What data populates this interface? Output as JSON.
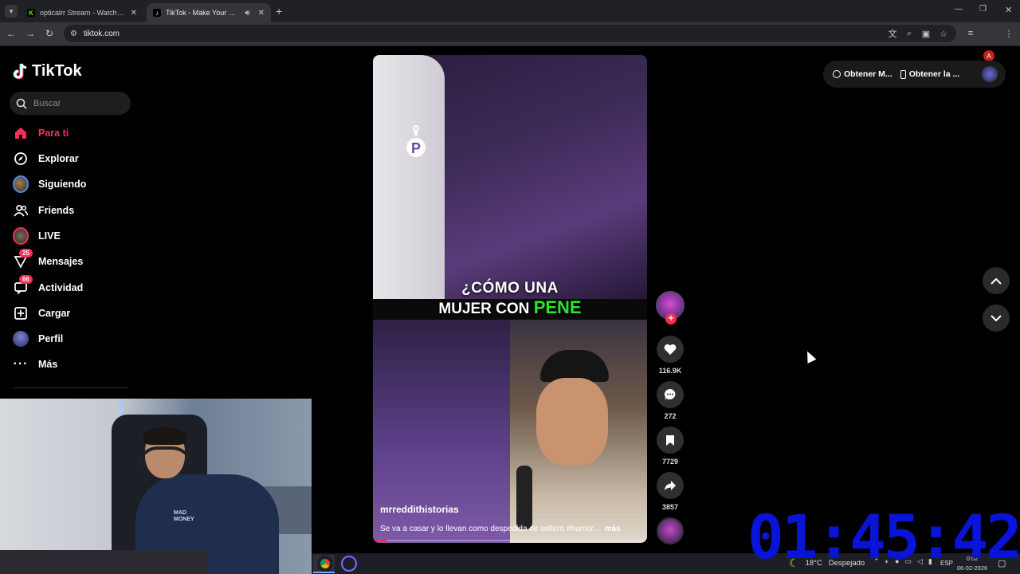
{
  "browser": {
    "tabs": [
      {
        "title": "opticalrr Stream - Watch Live o",
        "favicon_color": "#53fc18",
        "favicon_glyph": "K",
        "active": false
      },
      {
        "title": "TikTok - Make Your Day",
        "favicon_color": "#000000",
        "favicon_glyph": "♪",
        "active": true
      }
    ],
    "url": "tiktok.com",
    "profile_initial": "A"
  },
  "sidebar": {
    "logo_text": "TikTok",
    "search_placeholder": "Buscar",
    "items": [
      {
        "label": "Para ti",
        "icon": "home-icon",
        "active": true
      },
      {
        "label": "Explorar",
        "icon": "compass-icon"
      },
      {
        "label": "Siguiendo",
        "icon": "following-avatar"
      },
      {
        "label": "Friends",
        "icon": "friends-icon"
      },
      {
        "label": "LIVE",
        "icon": "live-avatar"
      },
      {
        "label": "Mensajes",
        "icon": "messages-icon",
        "badge": "25"
      },
      {
        "label": "Actividad",
        "icon": "activity-icon",
        "badge": "66"
      },
      {
        "label": "Cargar",
        "icon": "upload-icon"
      },
      {
        "label": "Perfil",
        "icon": "profile-avatar"
      },
      {
        "label": "Más",
        "icon": "more-icon"
      }
    ]
  },
  "video": {
    "caption_line1": "¿CÓMO UNA",
    "caption_line2_prefix": "MUJER CON ",
    "caption_line2_highlight": "PENE",
    "username": "mrreddithistorias",
    "description": "Se va a casar y lo llevan como despedida de soltero #humor...",
    "more_label": "más",
    "progress": 0.04,
    "watermark": "P"
  },
  "actions": {
    "likes": "116.9K",
    "comments": "272",
    "saves": "7729",
    "shares": "3857"
  },
  "topbar": {
    "get_coins_label": "Obtener M...",
    "get_app_label": "Obtener la ..."
  },
  "webcam": {
    "shirt_text_line1": "MAD",
    "shirt_text_line2": "MONEY"
  },
  "stream_timer": "01:45:42",
  "taskbar": {
    "temperature": "18°C",
    "weather": "Despejado",
    "language": "ESP",
    "time": "0:02",
    "date": "06-02-2026"
  },
  "colors": {
    "accent": "#fe2c55",
    "highlight_green": "#2ee32e",
    "timer_blue": "#0a14d8"
  }
}
